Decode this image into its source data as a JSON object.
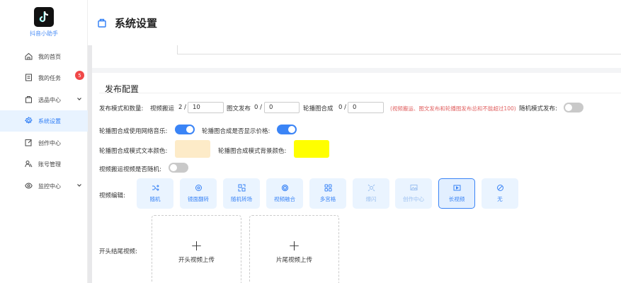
{
  "app": {
    "logo_text": "抖音小助手"
  },
  "sidebar": {
    "items": [
      {
        "label": "我的首页",
        "icon": "home-icon"
      },
      {
        "label": "我的任务",
        "icon": "task-icon",
        "badge": "5"
      },
      {
        "label": "选品中心",
        "icon": "bag-icon"
      },
      {
        "label": "系统设置",
        "icon": "gear-icon",
        "active": true
      },
      {
        "label": "创作中心",
        "icon": "edit-icon"
      },
      {
        "label": "账号管理",
        "icon": "users-icon"
      },
      {
        "label": "监控中心",
        "icon": "eye-icon"
      }
    ]
  },
  "header": {
    "title": "系统设置",
    "icon": "bag-icon"
  },
  "publish": {
    "section_title": "发布配置",
    "mode_label": "发布模式和数量:",
    "video_label": "视频搬运",
    "video_count": "2 /",
    "video_value": "10",
    "image_label": "图文发布",
    "image_count": "0 /",
    "image_value": "0",
    "carousel_label": "轮播图合成",
    "carousel_count": "0 /",
    "carousel_value": "0",
    "warning": "(视频搬运、图文发布和轮播图发布总和不能超过100)",
    "random_label": "随机模式发布:",
    "random_on": false,
    "music_label": "轮播图合成使用网络音乐:",
    "music_on": true,
    "price_label": "轮播图合成是否显示价格:",
    "price_on": true,
    "text_color_label": "轮播图合成模式文本颜色:",
    "text_color": "#fdebc8",
    "bg_color_label": "轮播图合成模式背景颜色:",
    "bg_color": "#ffff00",
    "random_video_label": "视频搬运视频是否随机:",
    "random_video_on": false,
    "edit_label": "视频编辑:",
    "edit_options": [
      {
        "label": "随机",
        "icon": "shuffle-icon"
      },
      {
        "label": "镜面翻转",
        "icon": "flip-icon"
      },
      {
        "label": "随机转场",
        "icon": "transition-icon"
      },
      {
        "label": "视频融合",
        "icon": "blend-icon"
      },
      {
        "label": "多宫格",
        "icon": "grid-icon"
      },
      {
        "label": "爆闪",
        "icon": "flash-icon"
      },
      {
        "label": "创作中心",
        "icon": "image-icon"
      },
      {
        "label": "长视频",
        "icon": "video-icon",
        "selected": true
      },
      {
        "label": "无",
        "icon": "ban-icon"
      }
    ],
    "head_tail_label": "开头结尾视频:",
    "head_upload": "开头视频上传",
    "tail_upload": "片尾视频上传"
  },
  "colors": {
    "accent": "#3a84f6",
    "danger": "#f04848"
  }
}
